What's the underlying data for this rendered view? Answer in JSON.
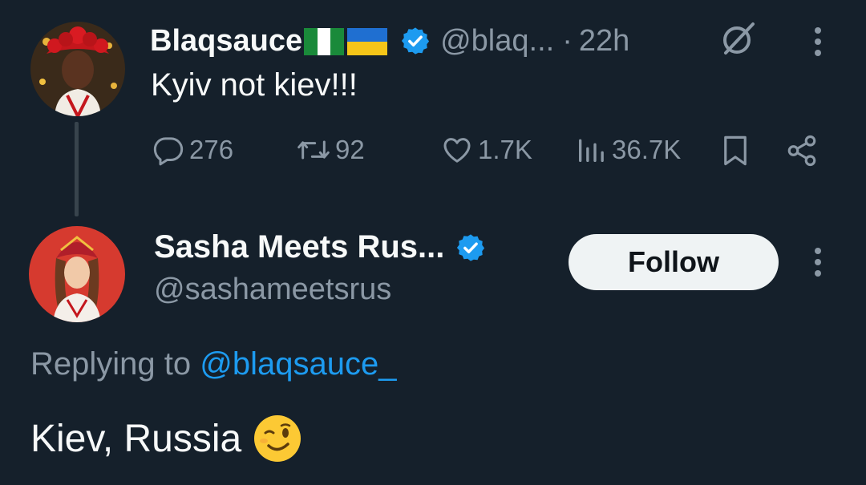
{
  "tweet1": {
    "display_name": "Blaqsauce",
    "flags": [
      "nigeria-flag",
      "ukraine-flag"
    ],
    "verified": true,
    "handle": "@blaq...",
    "separator": "·",
    "time": "22h",
    "text": "Kyiv not kiev!!!",
    "actions": {
      "replies": "276",
      "reposts": "92",
      "likes": "1.7K",
      "views": "36.7K"
    }
  },
  "tweet2": {
    "display_name": "Sasha Meets Rus...",
    "verified": true,
    "handle": "@sashameetsrus",
    "follow_label": "Follow",
    "replying_prefix": "Replying to ",
    "replying_to": "@blaqsauce_",
    "text": "Kiev, Russia",
    "emoji": "winking-face"
  },
  "colors": {
    "background": "#15202b",
    "text_primary": "#f7f9f9",
    "text_secondary": "#8b98a5",
    "accent": "#1d9bf0",
    "follow_button_bg": "#eff3f4"
  }
}
